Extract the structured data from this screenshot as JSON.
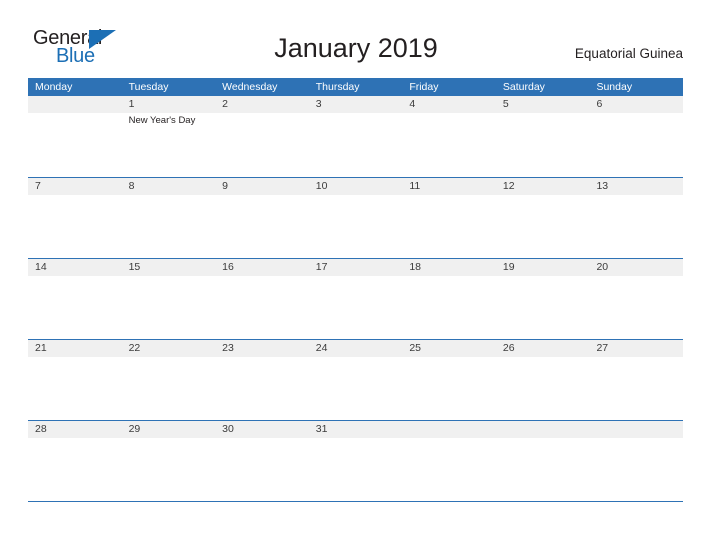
{
  "brand": {
    "name_part1": "General",
    "name_part2": "Blue",
    "logo_color": "#1c6fb5"
  },
  "header": {
    "title": "January 2019",
    "country": "Equatorial Guinea"
  },
  "theme": {
    "header_blue": "#2e72b5",
    "band_gray": "#f0f0f0",
    "text_dark": "#231f20"
  },
  "calendar": {
    "month": "January",
    "year": "2019",
    "weekday_headers": [
      "Monday",
      "Tuesday",
      "Wednesday",
      "Thursday",
      "Friday",
      "Saturday",
      "Sunday"
    ],
    "weeks": [
      [
        {
          "date": "",
          "event": ""
        },
        {
          "date": "1",
          "event": "New Year's Day"
        },
        {
          "date": "2",
          "event": ""
        },
        {
          "date": "3",
          "event": ""
        },
        {
          "date": "4",
          "event": ""
        },
        {
          "date": "5",
          "event": ""
        },
        {
          "date": "6",
          "event": ""
        }
      ],
      [
        {
          "date": "7",
          "event": ""
        },
        {
          "date": "8",
          "event": ""
        },
        {
          "date": "9",
          "event": ""
        },
        {
          "date": "10",
          "event": ""
        },
        {
          "date": "11",
          "event": ""
        },
        {
          "date": "12",
          "event": ""
        },
        {
          "date": "13",
          "event": ""
        }
      ],
      [
        {
          "date": "14",
          "event": ""
        },
        {
          "date": "15",
          "event": ""
        },
        {
          "date": "16",
          "event": ""
        },
        {
          "date": "17",
          "event": ""
        },
        {
          "date": "18",
          "event": ""
        },
        {
          "date": "19",
          "event": ""
        },
        {
          "date": "20",
          "event": ""
        }
      ],
      [
        {
          "date": "21",
          "event": ""
        },
        {
          "date": "22",
          "event": ""
        },
        {
          "date": "23",
          "event": ""
        },
        {
          "date": "24",
          "event": ""
        },
        {
          "date": "25",
          "event": ""
        },
        {
          "date": "26",
          "event": ""
        },
        {
          "date": "27",
          "event": ""
        }
      ],
      [
        {
          "date": "28",
          "event": ""
        },
        {
          "date": "29",
          "event": ""
        },
        {
          "date": "30",
          "event": ""
        },
        {
          "date": "31",
          "event": ""
        },
        {
          "date": "",
          "event": ""
        },
        {
          "date": "",
          "event": ""
        },
        {
          "date": "",
          "event": ""
        }
      ]
    ]
  }
}
